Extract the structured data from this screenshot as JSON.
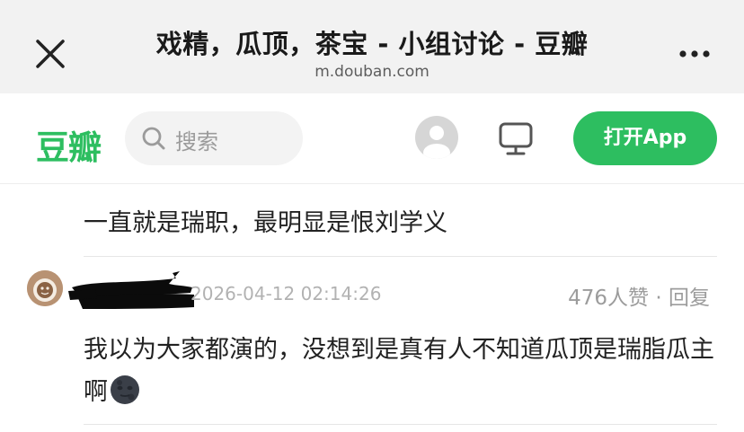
{
  "browser": {
    "title": "戏精，瓜顶，茶宝 - 小组讨论 - 豆瓣",
    "url": "m.douban.com"
  },
  "header": {
    "logo": "豆瓣",
    "search_placeholder": "搜索",
    "open_app_label": "打开App"
  },
  "content": {
    "quoted_line": "一直就是瑞职，最明显是恨刘学义",
    "comment": {
      "timestamp": "2026-04-12 02:14:26",
      "likes": "476人赞",
      "separator": " · ",
      "reply_label": "回复",
      "text": "我以为大家都演的，没想到是真有人不知道瓜顶是瑞脂瓜主啊",
      "trailing_emoji": "new-moon-face-emoji"
    }
  },
  "colors": {
    "brand_green": "#2dbe60",
    "titlebar_bg": "#f2f2f2",
    "text": "#222222",
    "muted": "#9c9c9c"
  }
}
